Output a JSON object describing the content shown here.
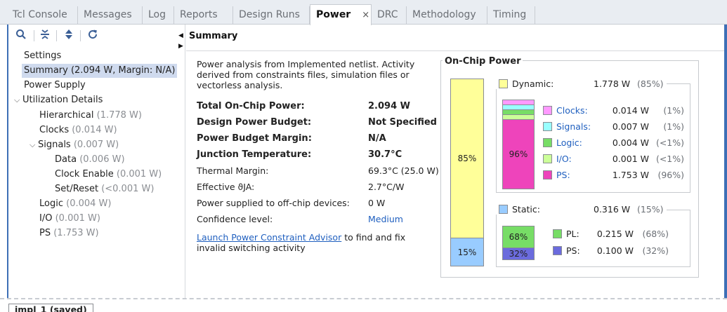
{
  "tabs": [
    {
      "label": "Tcl Console"
    },
    {
      "label": "Messages"
    },
    {
      "label": "Log"
    },
    {
      "label": "Reports"
    },
    {
      "label": "Design Runs"
    },
    {
      "label": "Power",
      "close": "×"
    },
    {
      "label": "DRC"
    },
    {
      "label": "Methodology"
    },
    {
      "label": "Timing"
    }
  ],
  "toolbar": {
    "icons": [
      "search-icon",
      "collapse-all-icon",
      "expand-all-icon",
      "refresh-icon"
    ]
  },
  "tree": {
    "settings": "Settings",
    "summary": "Summary (2.094 W, Margin: N/A)",
    "power_supply": "Power Supply",
    "utilization": "Utilization Details",
    "hierarchical": "Hierarchical",
    "hierarchical_val": "(1.778 W)",
    "clocks": "Clocks",
    "clocks_val": "(0.014 W)",
    "signals": "Signals",
    "signals_val": "(0.007 W)",
    "data": "Data",
    "data_val": "(0.006 W)",
    "clock_enable": "Clock Enable",
    "clock_enable_val": "(0.001 W)",
    "set_reset": "Set/Reset",
    "set_reset_val": "(<0.001 W)",
    "logic": "Logic",
    "logic_val": "(0.004 W)",
    "io": "I/O",
    "io_val": "(0.001 W)",
    "ps": "PS",
    "ps_val": "(1.753 W)"
  },
  "header": {
    "title": "Summary"
  },
  "summary": {
    "description": "Power analysis from Implemented netlist. Activity derived from constraints files, simulation files or vectorless analysis.",
    "rows": [
      {
        "label": "Total On-Chip Power:",
        "value": "2.094 W"
      },
      {
        "label": "Design Power Budget:",
        "value": "Not Specified"
      },
      {
        "label": "Power Budget Margin:",
        "value": "N/A"
      },
      {
        "label": "Junction Temperature:",
        "value": "30.7°C"
      },
      {
        "label": "Thermal Margin:",
        "value": "69.3°C (25.0 W)"
      },
      {
        "label": "Effective ϑJA:",
        "value": "2.7°C/W"
      },
      {
        "label": "Power supplied to off-chip devices:",
        "value": "0 W"
      },
      {
        "label": "Confidence level:",
        "value": "Medium"
      }
    ],
    "advisor_link": "Launch Power Constraint Advisor",
    "advisor_text": " to find and fix invalid switching activity"
  },
  "on_chip": {
    "title": "On-Chip Power",
    "dynamic_pct_label": "85%",
    "static_pct_label": "15%",
    "dynamic": {
      "label": "Dynamic:",
      "watts": "1.778 W",
      "pct": "(85%)",
      "fraction": 0.85
    },
    "static": {
      "label": "Static:",
      "watts": "0.316 W",
      "pct": "(15%)",
      "fraction": 0.15
    },
    "dynamic_items": [
      {
        "name": "Clocks:",
        "watts": "0.014 W",
        "pct": "(1%)",
        "color": "#ff99ff",
        "link": true
      },
      {
        "name": "Signals:",
        "watts": "0.007 W",
        "pct": "(1%)",
        "color": "#99ffff",
        "link": true
      },
      {
        "name": "Logic:",
        "watts": "0.004 W",
        "pct": "(<1%)",
        "color": "#77dd66",
        "link": true
      },
      {
        "name": "I/O:",
        "watts": "0.001 W",
        "pct": "(<1%)",
        "color": "#ccff99",
        "link": true
      },
      {
        "name": "PS:",
        "watts": "1.753 W",
        "pct": "(96%)",
        "color": "#ee44bb",
        "link": true
      }
    ],
    "dynamic_mini_label": "96%",
    "static_items": [
      {
        "name": "PL:",
        "watts": "0.215 W",
        "pct": "(68%)",
        "color": "#77dd66"
      },
      {
        "name": "PS:",
        "watts": "0.100 W",
        "pct": "(32%)",
        "color": "#6b6bdd"
      }
    ],
    "static_mini_pl": "68%",
    "static_mini_ps": "32%",
    "colors": {
      "dynamic": "#ffff99",
      "static": "#99ccff"
    }
  },
  "bottom": {
    "tab": "impl_1 (saved)"
  }
}
